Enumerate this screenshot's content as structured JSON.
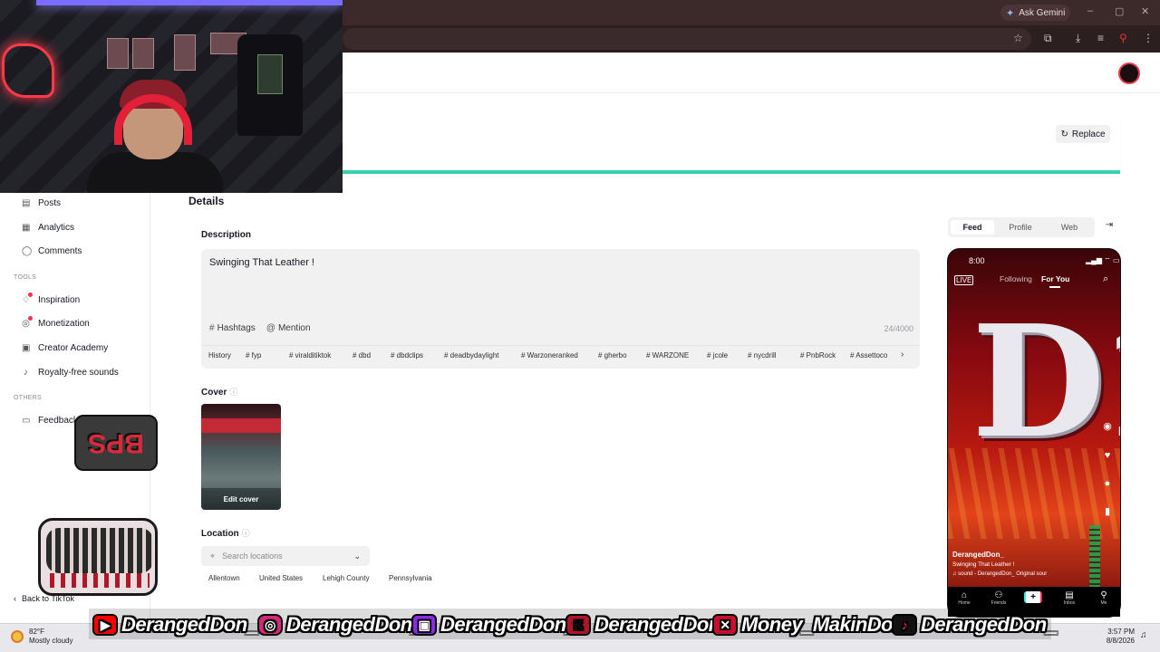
{
  "browser": {
    "gemini_label": "Ask Gemini",
    "icons": [
      "star-icon",
      "extensions-icon",
      "download-icon",
      "queue-icon",
      "profile-icon",
      "menu-icon"
    ]
  },
  "upload": {
    "replace_label": "Replace"
  },
  "sidebar": {
    "items": [
      {
        "label": "Posts",
        "icon": "posts-icon"
      },
      {
        "label": "Analytics",
        "icon": "analytics-icon"
      },
      {
        "label": "Comments",
        "icon": "comments-icon"
      }
    ],
    "tools_header": "TOOLS",
    "tools": [
      {
        "label": "Inspiration",
        "icon": "bulb-icon"
      },
      {
        "label": "Monetization",
        "icon": "coin-icon"
      },
      {
        "label": "Creator Academy",
        "icon": "academy-icon"
      },
      {
        "label": "Royalty-free sounds",
        "icon": "music-icon"
      }
    ],
    "others_header": "OTHERS",
    "others": [
      {
        "label": "Feedback",
        "icon": "feedback-icon"
      }
    ],
    "back_label": "Back to TikTok"
  },
  "stickers": {
    "bps": "BPS"
  },
  "details": {
    "title": "Details",
    "description_label": "Description",
    "description_value": "Swinging That Leather !",
    "hashtags_label": "Hashtags",
    "mention_label": "Mention",
    "counter": "24/4000",
    "history_label": "History",
    "tags": [
      "# fyp",
      "# viralditiktok",
      "# dbd",
      "# dbdclips",
      "# deadbydaylight",
      "# Warzoneranked",
      "# gherbo",
      "# WARZONE",
      "# jcole",
      "# nycdrill",
      "# PnbRock",
      "# Assettoco"
    ],
    "cover_label": "Cover",
    "edit_cover_label": "Edit cover",
    "location_label": "Location",
    "location_placeholder": "Search locations",
    "location_chips": [
      "Allentown",
      "United States",
      "Lehigh County",
      "Pennsylvania"
    ]
  },
  "preview": {
    "tabs": [
      "Feed",
      "Profile",
      "Web"
    ],
    "active_tab": "Feed",
    "phone": {
      "time": "8:00",
      "nav_following": "Following",
      "nav_foryou": "For You",
      "username": "DerangedDon_",
      "caption": "Swinging That Leather !",
      "sound": "♫ sound - DerangedDon_   Original sour",
      "bottom_nav": [
        "Home",
        "Friends",
        "",
        "Inbox",
        "Me"
      ]
    }
  },
  "banner": {
    "youtube": "DerangedDon_",
    "instagram": "DerangedDon_",
    "twitch": "DerangedDon_",
    "kick": "DerangedDon",
    "x": "Money_MakinDon",
    "tiktok": "DerangedDon_"
  },
  "taskbar": {
    "temp": "82°F",
    "weather": "Mostly cloudy",
    "time": "3:57 PM",
    "date": "8/8/2026"
  }
}
